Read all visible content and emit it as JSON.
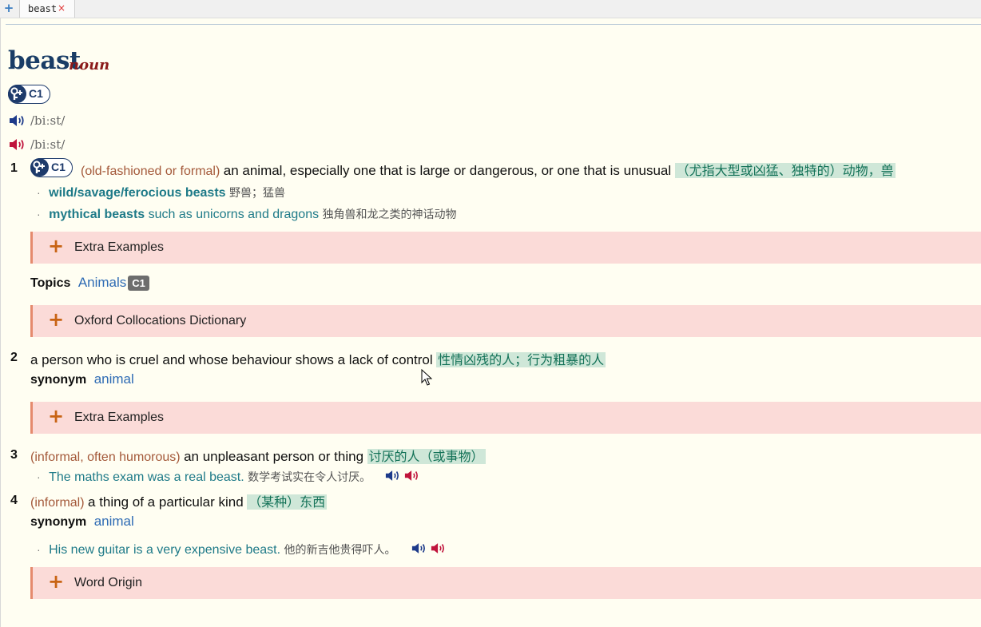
{
  "tabs": {
    "add_icon": "plus-icon",
    "active_label": "beast",
    "close_glyph": "×"
  },
  "entry": {
    "headword": "beast",
    "pos": "noun",
    "level": "C1",
    "pron_uk": "/biːst/",
    "pron_us": "/biːst/"
  },
  "senses": [
    {
      "num": "1",
      "level": "C1",
      "label": "(old-fashioned or formal)",
      "def": "an animal, especially one that is large or dangerous, or one that is unusual",
      "zh": "（尤指大型或凶猛、独特的）动物，兽",
      "examples": [
        {
          "bold": "wild/savage/ferocious beasts",
          "rest": "",
          "zh": "野兽；猛兽"
        },
        {
          "bold": "mythical beasts",
          "rest": " such as unicorns and dragons",
          "zh": "独角兽和龙之类的神话动物"
        }
      ],
      "extra_label": "Extra Examples",
      "topics_label": "Topics",
      "topic": "Animals",
      "topic_level": "C1",
      "collocations_label": "Oxford Collocations Dictionary"
    },
    {
      "num": "2",
      "def": "a person who is cruel and whose behaviour shows a lack of control",
      "zh": "性情凶残的人；行为粗暴的人",
      "synonym_label": "synonym",
      "synonym": "animal",
      "extra_label": "Extra Examples"
    },
    {
      "num": "3",
      "label": "(informal, often humorous)",
      "def": "an unpleasant person or thing",
      "zh": "讨厌的人（或事物）",
      "example": "The maths exam was a real beast.",
      "example_zh": "数学考试实在令人讨厌。"
    },
    {
      "num": "4",
      "label": "(informal)",
      "def": "a thing of a particular kind",
      "zh": "（某种）东西",
      "synonym_label": "synonym",
      "synonym": "animal",
      "example": "His new guitar is a very expensive beast.",
      "example_zh": "他的新吉他贵得吓人。"
    }
  ],
  "word_origin_label": "Word Origin",
  "bullet": "·",
  "colors": {
    "uk_speaker": "#1d3a8a",
    "us_speaker": "#c0143c",
    "headword": "#1a3d66",
    "pos": "#8b1a1a",
    "expander_bg": "#fbdbd8",
    "expander_border": "#e58a6d",
    "plus": "#c86414",
    "zh_highlight": "#cfe7d8",
    "example": "#1e7a88",
    "link": "#2e6bb4"
  }
}
